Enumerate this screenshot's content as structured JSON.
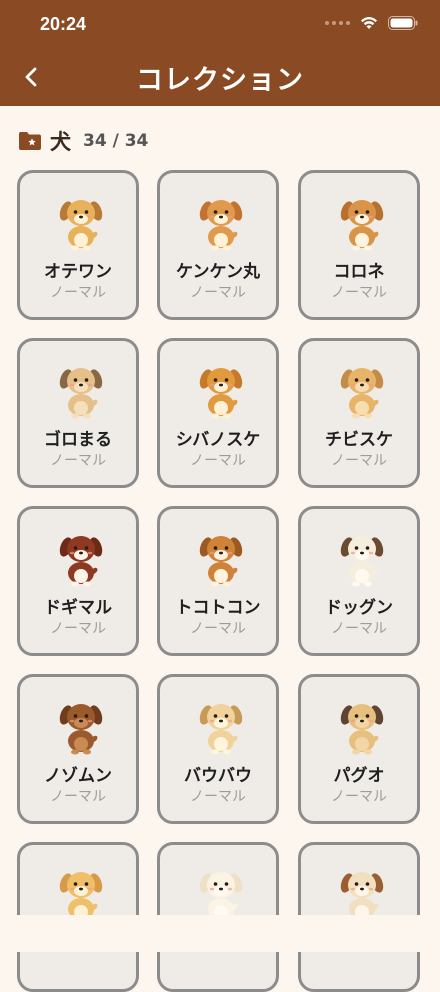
{
  "status": {
    "time": "20:24"
  },
  "header": {
    "title": "コレクション"
  },
  "section": {
    "title": "犬",
    "count": "34 / 34",
    "icon": "folder-star-icon"
  },
  "colors": {
    "header": "#8a4b24",
    "background": "#fcf6ef",
    "card": "#efebe7",
    "card_border": "#8c8c8c"
  },
  "cards": [
    {
      "name": "オテワン",
      "rarity": "ノーマル",
      "fur": "#e8b25a",
      "ear": "#b87a35",
      "belly": "#fff2d6"
    },
    {
      "name": "ケンケン丸",
      "rarity": "ノーマル",
      "fur": "#e09a4e",
      "ear": "#c27332",
      "belly": "#fff2d6"
    },
    {
      "name": "コロネ",
      "rarity": "ノーマル",
      "fur": "#d99448",
      "ear": "#b8702f",
      "belly": "#fff4e0"
    },
    {
      "name": "ゴロまる",
      "rarity": "ノーマル",
      "fur": "#e6c08a",
      "ear": "#8a6744",
      "belly": "#f5e0bd"
    },
    {
      "name": "シバノスケ",
      "rarity": "ノーマル",
      "fur": "#e29a3e",
      "ear": "#c77a2a",
      "belly": "#fff1d8"
    },
    {
      "name": "チビスケ",
      "rarity": "ノーマル",
      "fur": "#e7b46a",
      "ear": "#c48c46",
      "belly": "#f7ddb0"
    },
    {
      "name": "ドギマル",
      "rarity": "ノーマル",
      "fur": "#8e3a22",
      "ear": "#6e2a16",
      "belly": "#fff4ea"
    },
    {
      "name": "トコトコン",
      "rarity": "ノーマル",
      "fur": "#cf8338",
      "ear": "#9c5a22",
      "belly": "#fff3e0"
    },
    {
      "name": "ドッグン",
      "rarity": "ノーマル",
      "fur": "#f6eedc",
      "ear": "#6b4a30",
      "belly": "#fffaf0"
    },
    {
      "name": "ノゾムン",
      "rarity": "ノーマル",
      "fur": "#9a5a2c",
      "ear": "#6f3d1b",
      "belly": "#c98a55"
    },
    {
      "name": "バウバウ",
      "rarity": "ノーマル",
      "fur": "#f0d29a",
      "ear": "#c79a55",
      "belly": "#fff4de"
    },
    {
      "name": "パグオ",
      "rarity": "ノーマル",
      "fur": "#e7c080",
      "ear": "#5e4432",
      "belly": "#f3d6a6"
    },
    {
      "name": "",
      "rarity": "",
      "fur": "#f0bf6a",
      "ear": "#d89a48",
      "belly": "#fff1d6"
    },
    {
      "name": "",
      "rarity": "",
      "fur": "#fbf3e4",
      "ear": "#efe0c8",
      "belly": "#fffaf2"
    },
    {
      "name": "",
      "rarity": "",
      "fur": "#f1dfc0",
      "ear": "#9a5e30",
      "belly": "#fff6e8"
    }
  ]
}
